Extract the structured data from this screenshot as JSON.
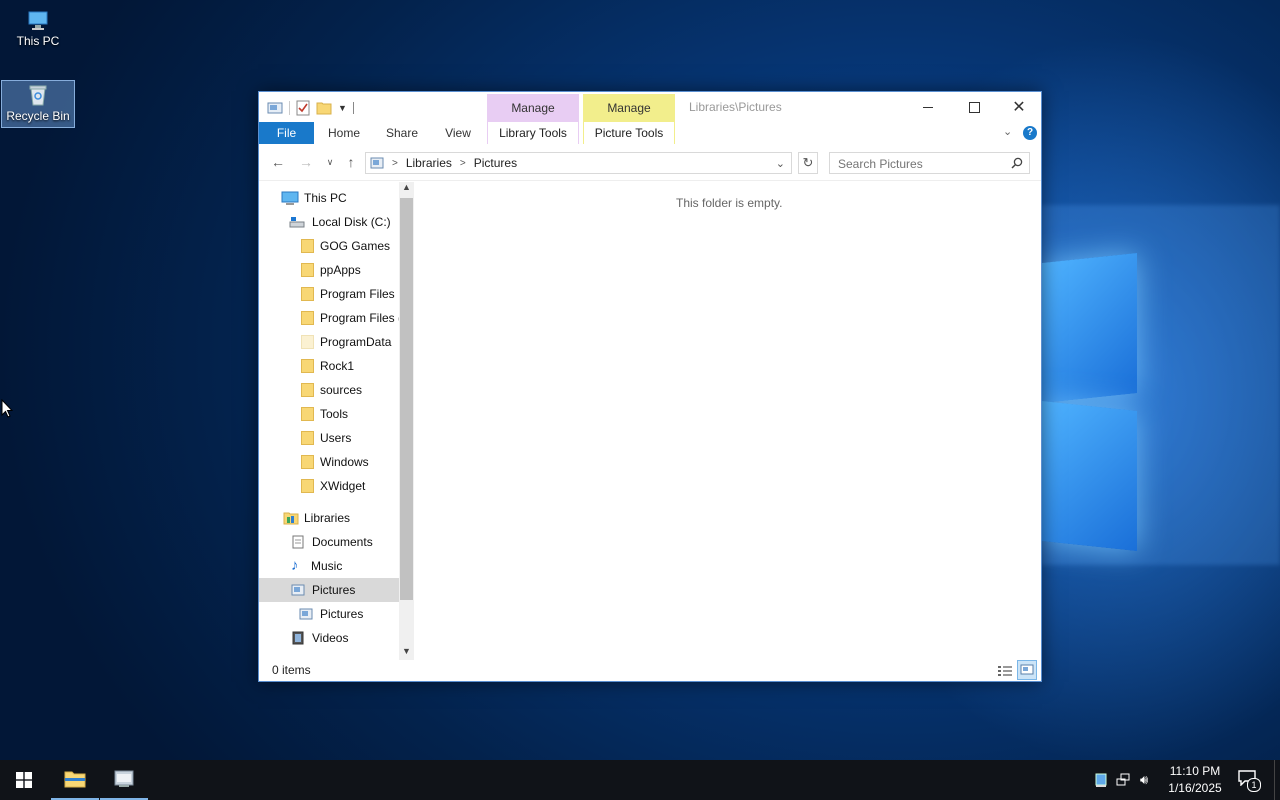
{
  "desktop": {
    "icons": [
      {
        "label": "This PC",
        "icon": "this-pc-icon"
      },
      {
        "label": "Recycle Bin",
        "icon": "recycle-bin-icon"
      }
    ]
  },
  "explorer": {
    "title": "Libraries\\Pictures",
    "context_tabs": [
      {
        "top": "Manage",
        "bottom": "Library Tools",
        "color": "#e8cdf3"
      },
      {
        "top": "Manage",
        "bottom": "Picture Tools",
        "color": "#f2ee8c"
      }
    ],
    "ribbon_tabs": [
      "File",
      "Home",
      "Share",
      "View"
    ],
    "address": {
      "segments": [
        "Libraries",
        "Pictures"
      ]
    },
    "search": {
      "placeholder": "Search Pictures"
    },
    "nav": {
      "this_pc": "This PC",
      "local_disk": "Local Disk (C:)",
      "folders": [
        "GOG Games",
        "ppApps",
        "Program Files",
        "Program Files (",
        "ProgramData",
        "Rock1",
        "sources",
        "Tools",
        "Users",
        "Windows",
        "XWidget"
      ],
      "libraries": "Libraries",
      "library_items": [
        "Documents",
        "Music",
        "Pictures",
        "Pictures",
        "Videos"
      ]
    },
    "content": {
      "empty_message": "This folder is empty."
    },
    "status": {
      "items": "0 items"
    }
  },
  "taskbar": {
    "time": "11:10 PM",
    "date": "1/16/2025",
    "notifications": "1"
  },
  "colors": {
    "accent": "#1979ca",
    "selection": "#d9d9d9"
  }
}
